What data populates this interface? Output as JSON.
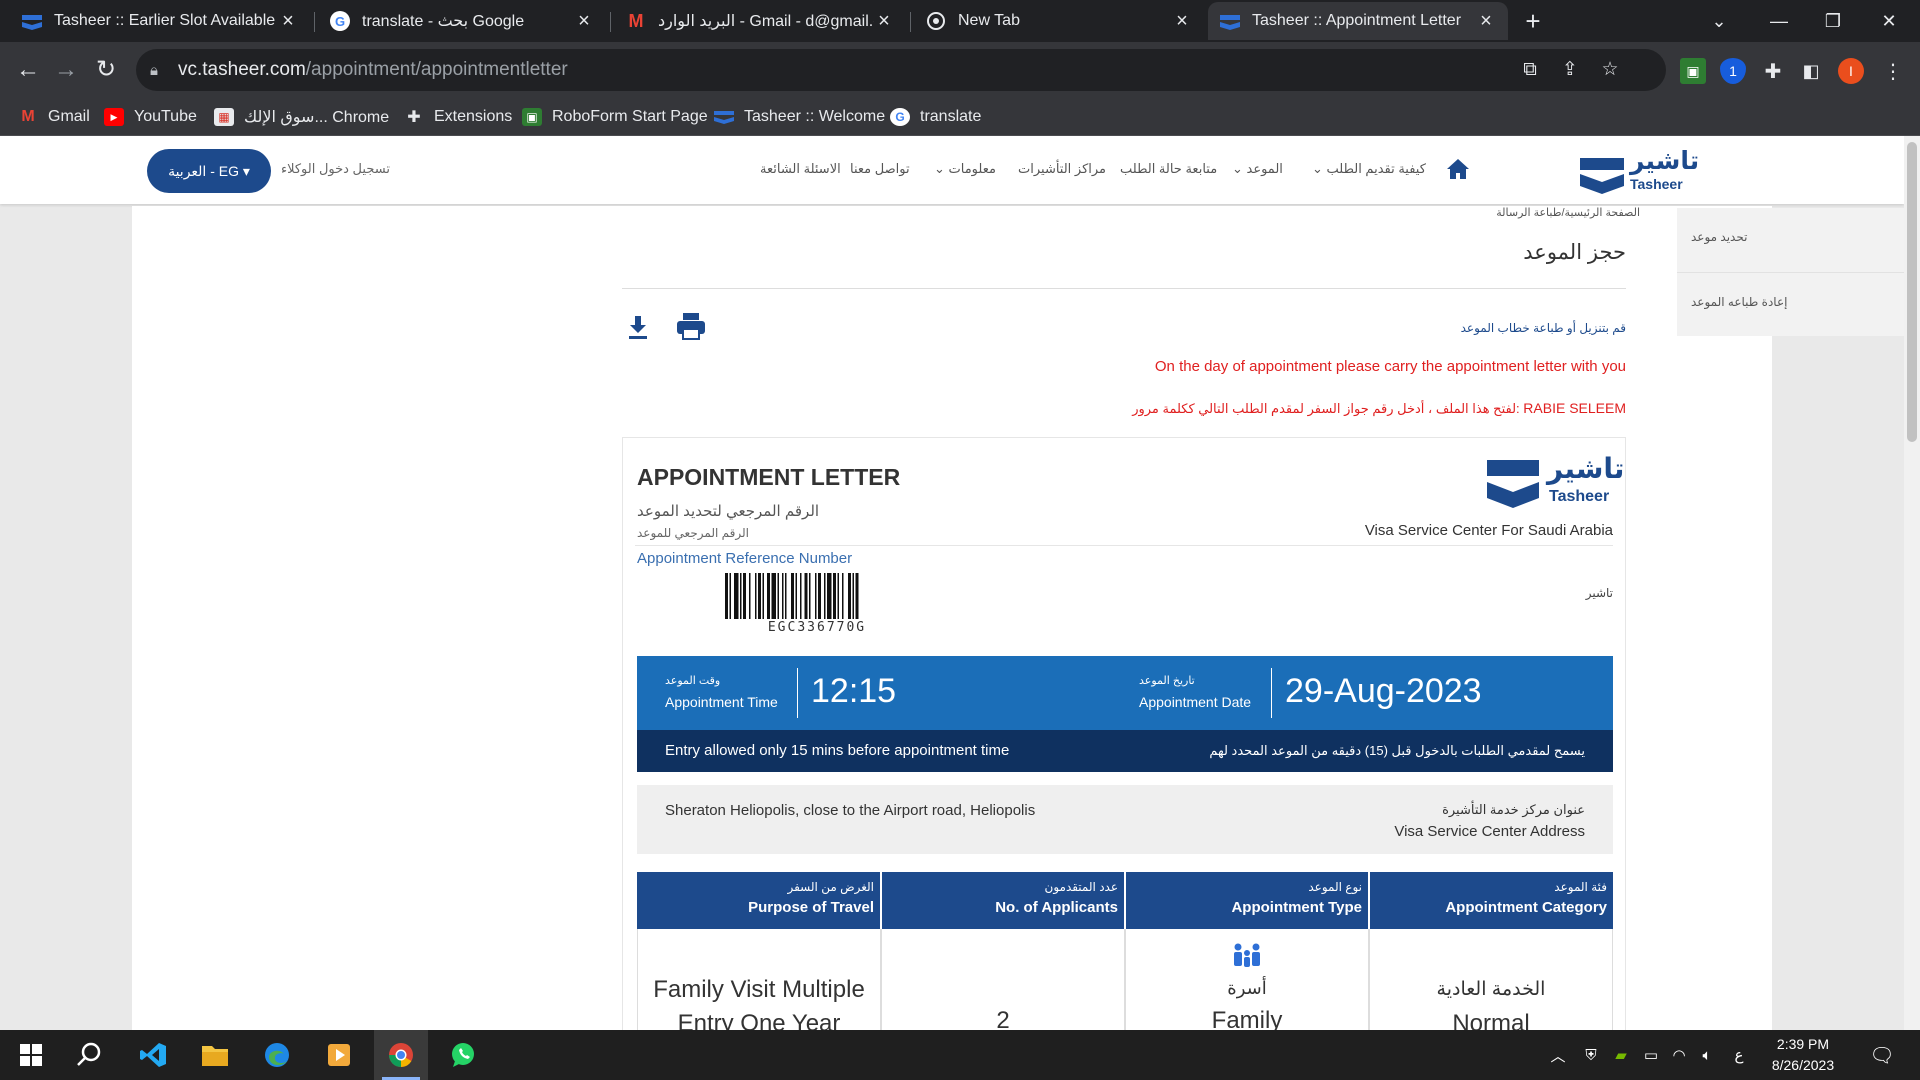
{
  "browser": {
    "tabs": [
      {
        "label": "Tasheer :: Earlier Slot Available",
        "icon": "tasheer-icon"
      },
      {
        "label": "translate - بحث Google",
        "icon": "google-icon"
      },
      {
        "label": "البريد الوارد - Gmail - d@gmail.com",
        "icon": "gmail-icon"
      },
      {
        "label": "New Tab",
        "icon": "chrome-icon"
      },
      {
        "label": "Tasheer :: Appointment Letter",
        "icon": "tasheer-icon"
      }
    ],
    "url_host": "vc.tasheer.com",
    "url_path": "/appointment/appointmentletter",
    "profile_initial": "I",
    "bookmarks": [
      "Gmail",
      "YouTube",
      "سوق الإلك... Chrome",
      "Extensions",
      "RoboForm Start Page",
      "Tasheer :: Welcome",
      "translate"
    ]
  },
  "site": {
    "lang_button": "العربية - EG ▾",
    "agent_login": "تسجيل دخول الوكلاء",
    "nav": [
      "كيفية تقديم الطلب",
      "الموعد",
      "متابعة حالة الطلب",
      "مراكز التأشيرات",
      "معلومات",
      "تواصل معنا",
      "الاسئلة الشائعة"
    ],
    "logo_ar": "تاشير",
    "logo_en": "Tasheer",
    "sidebar": [
      "تحديد موعد",
      "إعادة طباعه الموعد"
    ],
    "breadcrumb": "الصفحة الرئيسية/طباعة الرسالة",
    "page_title": "حجز الموعد",
    "download_text": "قم بتنزيل أو طباعة خطاب الموعد",
    "notice_en": "On the day of appointment please carry the appointment letter with you",
    "password_note": "لفتح هذا الملف ، أدخل رقم جواز السفر لمقدم الطلب التالي ككلمة مرور:",
    "password_name": "RABIE SELEEM"
  },
  "letter": {
    "title": "APPOINTMENT LETTER",
    "ref_label_ar": "الرقم المرجعي لتحديد الموعد",
    "ref_label_ar2": "الرقم المرجعي للموعد",
    "ref_label_en": "Appointment Reference Number",
    "reference_number": "EGC336770G",
    "logo_ar": "تاشير",
    "logo_en": "Tasheer",
    "center_name": "Visa Service Center For Saudi Arabia",
    "tasheer_ar": "تاشير",
    "time_label_ar": "وقت الموعد",
    "time_label_en": "Appointment Time",
    "time": "12:15",
    "date_label_ar": "تاريخ الموعد",
    "date_label_en": "Appointment Date",
    "date": "29-Aug-2023",
    "entry_en": "Entry allowed only 15 mins before appointment time",
    "entry_ar": "يسمح لمقدمي الطلبات بالدخول قبل (15) دقيقه من الموعد المحدد لهم",
    "address": "Sheraton Heliopolis, close to the Airport road, Heliopolis",
    "address_label_ar": "عنوان مركز خدمة التأشيرة",
    "address_label_en": "Visa Service Center Address",
    "columns": [
      {
        "ar": "الغرض من السفر",
        "en": "Purpose of Travel"
      },
      {
        "ar": "عدد المتقدمون",
        "en": "No. of Applicants"
      },
      {
        "ar": "نوع الموعد",
        "en": "Appointment Type"
      },
      {
        "ar": "فئة الموعد",
        "en": "Appointment Category"
      }
    ],
    "values": {
      "purpose_line1": "Family Visit Multiple",
      "purpose_line2": "Entry One Year",
      "applicants": "2",
      "type_ar": "أسرة",
      "type_en": "Family",
      "category_ar": "الخدمة العادية",
      "category_en": "Normal"
    }
  },
  "taskbar": {
    "time": "2:39 PM",
    "date": "8/26/2023",
    "lang": "ع"
  },
  "colors": {
    "brand": "#1d4a8c",
    "time_box": "#1b6eb8",
    "entry_bar": "#0f3160",
    "notice": "#e02020"
  }
}
